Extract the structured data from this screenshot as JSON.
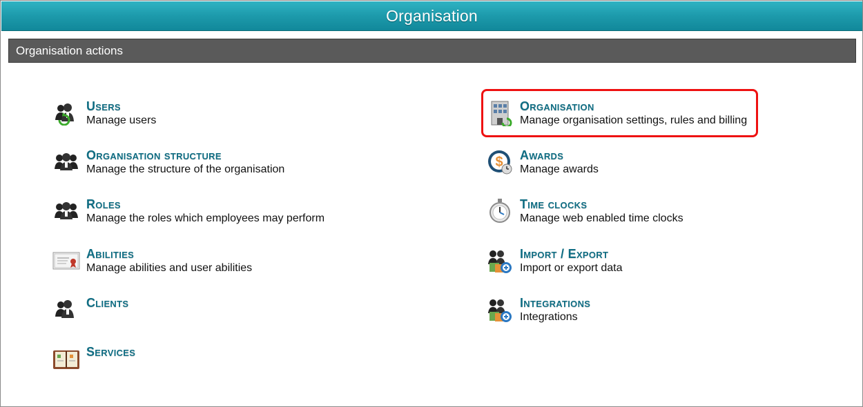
{
  "window": {
    "title": "Organisation"
  },
  "section": {
    "title": "Organisation actions"
  },
  "left_items": [
    {
      "title": "Users",
      "desc": "Manage users",
      "icon": "users-icon"
    },
    {
      "title": "Organisation structure",
      "desc": "Manage the structure of the organisation",
      "icon": "org-structure-icon"
    },
    {
      "title": "Roles",
      "desc": "Manage the roles which employees may perform",
      "icon": "roles-icon"
    },
    {
      "title": "Abilities",
      "desc": "Manage abilities and user abilities",
      "icon": "certificate-icon"
    },
    {
      "title": "Clients",
      "desc": "",
      "icon": "clients-icon"
    },
    {
      "title": "Services",
      "desc": "",
      "icon": "services-book-icon"
    }
  ],
  "right_items": [
    {
      "title": "Organisation",
      "desc": "Manage organisation settings, rules and billing",
      "icon": "building-icon"
    },
    {
      "title": "Awards",
      "desc": "Manage awards",
      "icon": "awards-dollar-icon"
    },
    {
      "title": "Time clocks",
      "desc": "Manage web enabled time clocks",
      "icon": "stopwatch-icon"
    },
    {
      "title": "Import / Export",
      "desc": "Import or export data",
      "icon": "import-export-icon"
    },
    {
      "title": "Integrations",
      "desc": "Integrations",
      "icon": "integrations-icon"
    }
  ],
  "colors": {
    "title_link": "#0f6d83",
    "titlebar": "#1d9aab",
    "section_bar": "#5a5a5a",
    "highlight": "#ee1111"
  }
}
